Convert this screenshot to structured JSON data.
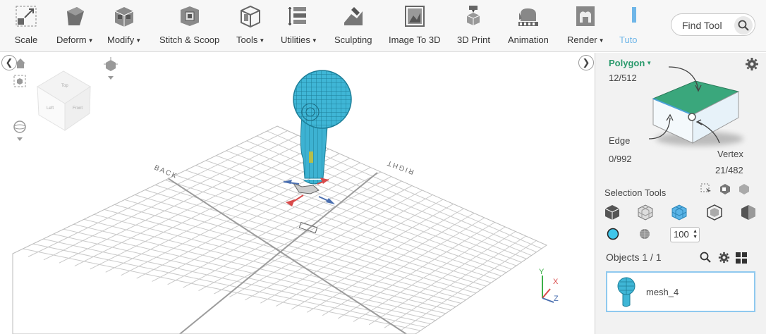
{
  "toolbar": {
    "items": [
      {
        "label": "Scale",
        "dropdown": false,
        "icon": "scale-icon"
      },
      {
        "label": "Deform",
        "dropdown": true,
        "icon": "deform-icon"
      },
      {
        "label": "Modify",
        "dropdown": true,
        "icon": "modify-icon"
      },
      {
        "label": "Stitch & Scoop",
        "dropdown": false,
        "icon": "stitch-scoop-icon"
      },
      {
        "label": "Tools",
        "dropdown": true,
        "icon": "tools-icon"
      },
      {
        "label": "Utilities",
        "dropdown": true,
        "icon": "utilities-icon"
      },
      {
        "label": "Sculpting",
        "dropdown": false,
        "icon": "sculpting-icon"
      },
      {
        "label": "Image To 3D",
        "dropdown": false,
        "icon": "image-to-3d-icon"
      },
      {
        "label": "3D Print",
        "dropdown": false,
        "icon": "3d-print-icon"
      },
      {
        "label": "Animation",
        "dropdown": false,
        "icon": "animation-icon"
      },
      {
        "label": "Render",
        "dropdown": true,
        "icon": "render-icon"
      },
      {
        "label": "Tuto",
        "dropdown": false,
        "icon": "tutorials-icon",
        "active": true
      }
    ],
    "find_tool": {
      "placeholder": "Find Tool"
    }
  },
  "viewport": {
    "labels": {
      "back": "BACK",
      "right": "RIGHT"
    },
    "view_cube": {
      "top": "Top",
      "left": "Left",
      "front": "Front"
    },
    "axes": {
      "x": "X",
      "y": "Y",
      "z": "Z"
    }
  },
  "panel": {
    "mode": "Polygon",
    "polygon_count": "12/512",
    "edge_label": "Edge",
    "edge_count": "0/992",
    "vertex_label": "Vertex",
    "vertex_count": "21/482",
    "selection_tools_label": "Selection Tools",
    "brush_size": "100",
    "objects_label": "Objects 1 / 1",
    "object_name": "mesh_4"
  },
  "colors": {
    "accent_green": "#2a9a6c",
    "mesh_blue": "#3fb6d6",
    "face_green": "#3aa77c",
    "active_tab": "#6fb6e8"
  }
}
